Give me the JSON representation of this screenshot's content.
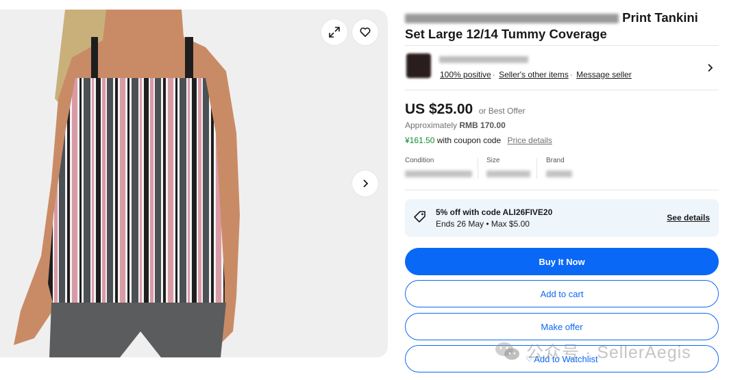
{
  "gallery": {
    "image_alt": "",
    "colors": {
      "stripe_pink": "#d99aa6",
      "stripe_black": "#1e1e1e",
      "stripe_gray": "#4b5055",
      "shorts": "#5a5c5e",
      "skin": "#c98b66"
    }
  },
  "listing": {
    "title_line1_visible": "Print Tankini",
    "title_line2": "Set Large 12/14 Tummy Coverage"
  },
  "seller": {
    "feedback": "100% positive",
    "other_items": "Seller's other items",
    "message": "Message seller"
  },
  "price": {
    "amount": "US $25.00",
    "best_offer": "or Best Offer",
    "approx_label": "Approximately",
    "approx_value": "RMB 170.00",
    "coupon_price": "¥161.50",
    "coupon_text": "with coupon code",
    "price_details": "Price details"
  },
  "specs": {
    "condition_label": "Condition",
    "size_label": "Size",
    "brand_label": "Brand"
  },
  "promo": {
    "title": "5% off with code ALI26FIVE20",
    "subtitle": "Ends 26 May • Max $5.00",
    "link": "See details"
  },
  "actions": {
    "buy_now": "Buy It Now",
    "add_to_cart": "Add to cart",
    "make_offer": "Make offer",
    "watchlist": "Add to Watchlist"
  },
  "watermark": {
    "text": "公众号 · SellerAegis"
  },
  "theme": {
    "accent": "#0968f6",
    "coupon_green": "#118a2e",
    "promo_bg": "#eef5fb"
  }
}
